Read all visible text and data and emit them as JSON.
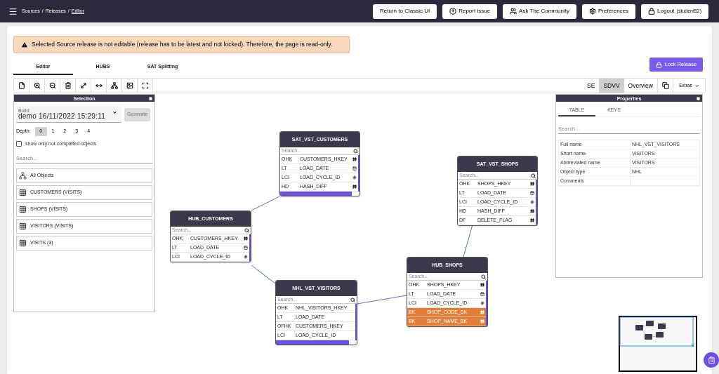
{
  "topbar": {
    "separator": "/",
    "breadcrumb": [
      {
        "label": "Sources",
        "selected": false
      },
      {
        "label": "Releases",
        "selected": false
      },
      {
        "label": "Editor",
        "selected": true
      }
    ],
    "buttons": [
      {
        "label": "Return to Classic UI",
        "kind": "plain"
      },
      {
        "label": "Report issue",
        "kind": "help"
      },
      {
        "label": "Ask The Community",
        "kind": "community"
      },
      {
        "label": "Preferences",
        "kind": "settings"
      },
      {
        "label": "Logout",
        "suffix": "(student52)",
        "kind": "logout"
      }
    ]
  },
  "alert": "Selected Source release is not editable (release has to be latest and not locked). Therefore, the page is read-only.",
  "tabs": [
    {
      "label": "Editor",
      "selected": true
    },
    {
      "label": "HUBS",
      "selected": false
    },
    {
      "label": "SAT Splitting",
      "selected": false
    }
  ],
  "lock_button": "Lock Release",
  "toolbar": {
    "views": [
      {
        "label": "SE",
        "selected": false
      },
      {
        "label": "SDVV",
        "selected": true
      },
      {
        "label": "Overview",
        "selected": false
      }
    ],
    "extras": "Extras"
  },
  "selection": {
    "title": "Selection",
    "build_label": "Build",
    "build_value": "demo 16/11/2022 15:29:11",
    "generate": {
      "label": "Generate",
      "disabled": true
    },
    "depth_label": "Depth:",
    "depth": [
      {
        "label": "0",
        "selected": true
      },
      {
        "label": "1",
        "selected": false
      },
      {
        "label": "2",
        "selected": false
      },
      {
        "label": "3",
        "selected": false
      },
      {
        "label": "4",
        "selected": false
      }
    ],
    "filter": {
      "label": "show only not completed objects",
      "checked": false
    },
    "search": {
      "placeholder": "Search..."
    },
    "items": [
      {
        "label": "All Objects",
        "kind": "all"
      },
      {
        "label": "CUSTOMERS (VISITS)",
        "kind": "table"
      },
      {
        "label": "SHOPS (VISITS)",
        "kind": "table"
      },
      {
        "label": "VISITORS (VISITS)",
        "kind": "table"
      },
      {
        "label": "VISITS (3)",
        "kind": "table"
      }
    ]
  },
  "properties": {
    "title": "Properties",
    "tabs": [
      {
        "label": "TABLE",
        "selected": true
      },
      {
        "label": "KEYS",
        "selected": false
      }
    ],
    "search": {
      "placeholder": "Search..."
    },
    "rows": [
      {
        "name": "Full name",
        "value": "NHL_VST_VISITORS"
      },
      {
        "name": "Short name",
        "value": "VISITORS"
      },
      {
        "name": "Abbreviated name",
        "value": "VISITORS"
      },
      {
        "name": "Object type",
        "value": "NHL"
      },
      {
        "name": "Comments"
      }
    ]
  },
  "nodes": [
    {
      "title": "SAT_VST_CUSTOMERS",
      "search": "Search...",
      "rows": [
        {
          "key": "OHK",
          "name": "CUSTOMERS_HKEY",
          "kind": "text",
          "highlighted": false
        },
        {
          "key": "LT",
          "name": "LOAD_DATE",
          "kind": "date",
          "highlighted": false
        },
        {
          "key": "LCI",
          "name": "LOAD_CYCLE_ID",
          "kind": "number",
          "highlighted": false
        },
        {
          "key": "HD",
          "name": "HASH_DIFF",
          "kind": "text",
          "highlighted": false
        }
      ]
    },
    {
      "title": "HUB_CUSTOMERS",
      "search": "Search...",
      "rows": [
        {
          "key": "OHK",
          "name": "CUSTOMERS_HKEY",
          "kind": "text",
          "highlighted": false
        },
        {
          "key": "LT",
          "name": "LOAD_DATE",
          "kind": "date",
          "highlighted": false
        },
        {
          "key": "LCI",
          "name": "LOAD_CYCLE_ID",
          "kind": "number",
          "highlighted": false
        }
      ]
    },
    {
      "title": "NHL_VST_VISITORS",
      "search": "Search...",
      "rows": [
        {
          "key": "OHK",
          "name": "NHL_VISITORS_HKEY",
          "kind": "plain",
          "highlighted": false
        },
        {
          "key": "LT",
          "name": "LOAD_DATE",
          "kind": "plain",
          "highlighted": false
        },
        {
          "key": "OFHK",
          "name": "CUSTOMERS_HKEY",
          "kind": "plain",
          "highlighted": false
        },
        {
          "key": "LCI",
          "name": "LOAD_CYCLE_ID",
          "kind": "plain",
          "highlighted": false
        }
      ]
    },
    {
      "title": "SAT_VST_SHOPS",
      "search": "Search...",
      "rows": [
        {
          "key": "OHK",
          "name": "SHOPS_HKEY",
          "kind": "text",
          "highlighted": false
        },
        {
          "key": "LT",
          "name": "LOAD_DATE",
          "kind": "date",
          "highlighted": false
        },
        {
          "key": "LCI",
          "name": "LOAD_CYCLE_ID",
          "kind": "number",
          "highlighted": false
        },
        {
          "key": "HD",
          "name": "HASH_DIFF",
          "kind": "text",
          "highlighted": false
        },
        {
          "key": "DF",
          "name": "DELETE_FLAG",
          "kind": "text",
          "highlighted": false
        }
      ]
    },
    {
      "title": "HUB_SHOPS",
      "search": "Search...",
      "rows": [
        {
          "key": "OHK",
          "name": "SHOPS_HKEY",
          "kind": "text",
          "highlighted": false
        },
        {
          "key": "LT",
          "name": "LOAD_DATE",
          "kind": "date",
          "highlighted": false
        },
        {
          "key": "LCI",
          "name": "LOAD_CYCLE_ID",
          "kind": "number",
          "highlighted": false
        },
        {
          "key": "BK",
          "name": "SHOP_CODE_BK",
          "kind": "text",
          "highlighted": true
        },
        {
          "key": "BK",
          "name": "SHOP_NAME_BK",
          "kind": "text",
          "highlighted": true
        }
      ]
    }
  ]
}
